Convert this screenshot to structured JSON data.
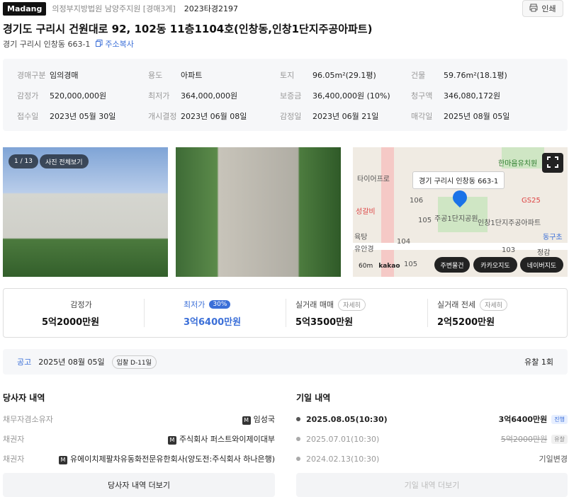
{
  "header": {
    "logo": "Madang",
    "court": "의정부지방법원 남양주지원 [경매3계]",
    "case_no": "2023타경2197",
    "print_label": "인쇄"
  },
  "title": "경기도 구리시 건원대로 92, 102동 11층1104호(인창동,인창1단지주공아파트)",
  "address": {
    "text": "경기 구리시 인창동 663-1",
    "copy_label": "주소복사"
  },
  "info": {
    "rows": [
      [
        {
          "k": "경매구분",
          "v": "임의경매"
        },
        {
          "k": "용도",
          "v": "아파트"
        },
        {
          "k": "토지",
          "v": "96.05m²(29.1평)"
        },
        {
          "k": "건물",
          "v": "59.76m²(18.1평)"
        }
      ],
      [
        {
          "k": "감정가",
          "v": "520,000,000원"
        },
        {
          "k": "최저가",
          "v": "364,000,000원"
        },
        {
          "k": "보증금",
          "v": "36,400,000원 (10%)"
        },
        {
          "k": "청구액",
          "v": "346,080,172원"
        }
      ],
      [
        {
          "k": "접수일",
          "v": "2023년 05월 30일"
        },
        {
          "k": "개시결정",
          "v": "2023년 06월 08일"
        },
        {
          "k": "감정일",
          "v": "2023년 06월 21일"
        },
        {
          "k": "매각일",
          "v": "2025년 08월 05일"
        }
      ]
    ]
  },
  "photos": {
    "counter": "1 / 13",
    "view_all": "사진 전체보기"
  },
  "map": {
    "tooltip": "경기 구리시 인창동 663-1",
    "labels": [
      "타이어프로",
      "한마음유치원",
      "성갈비",
      "106",
      "105",
      "주공1단지공원",
      "인창1단지주공아파트",
      "GS25",
      "동구초",
      "육탕",
      "유안경",
      "104",
      "103",
      "105",
      "정감"
    ],
    "scale": "60m",
    "brand": "kakao",
    "buttons": [
      "주변물건",
      "카카오지도",
      "네이버지도"
    ]
  },
  "prices": {
    "appraisal": {
      "label": "감정가",
      "value": "5억2000만원"
    },
    "minimum": {
      "label": "최저가",
      "pct": "30%",
      "value": "3억6400만원"
    },
    "trade": {
      "label": "실거래 매매",
      "chip": "자세히",
      "value": "5억3500만원"
    },
    "jeonse": {
      "label": "실거래 전세",
      "chip": "자세히",
      "value": "2억5200만원"
    }
  },
  "notice": {
    "label": "공고",
    "date": "2025년 08월 05일",
    "dday": "입찰 D-11일",
    "yuchal": "유찰 1회"
  },
  "parties": {
    "title": "당사자 내역",
    "rows": [
      {
        "k": "채무자겸소유자",
        "v": "임성국"
      },
      {
        "k": "채권자",
        "v": "주식회사 퍼스트와이제이대부"
      },
      {
        "k": "채권자",
        "v": "유에이치제팔차유동화전문유한회사(양도전:주식회사 하나은행)"
      }
    ],
    "more": "당사자 내역 더보기"
  },
  "dates": {
    "title": "기일 내역",
    "rows": [
      {
        "date": "2025.08.05(10:30)",
        "price": "3억6400만원",
        "tag": "진행",
        "active": true
      },
      {
        "date": "2025.07.01(10:30)",
        "price": "5억2000만원",
        "tag": "유찰",
        "active": false
      },
      {
        "date": "2024.02.13(10:30)",
        "price": "기일변경",
        "tag": "",
        "active": false
      }
    ],
    "more": "기일 내역 더보기"
  },
  "colors": {
    "accent": "#3b6fd8",
    "progress_tag_bg": "#e7efff"
  }
}
